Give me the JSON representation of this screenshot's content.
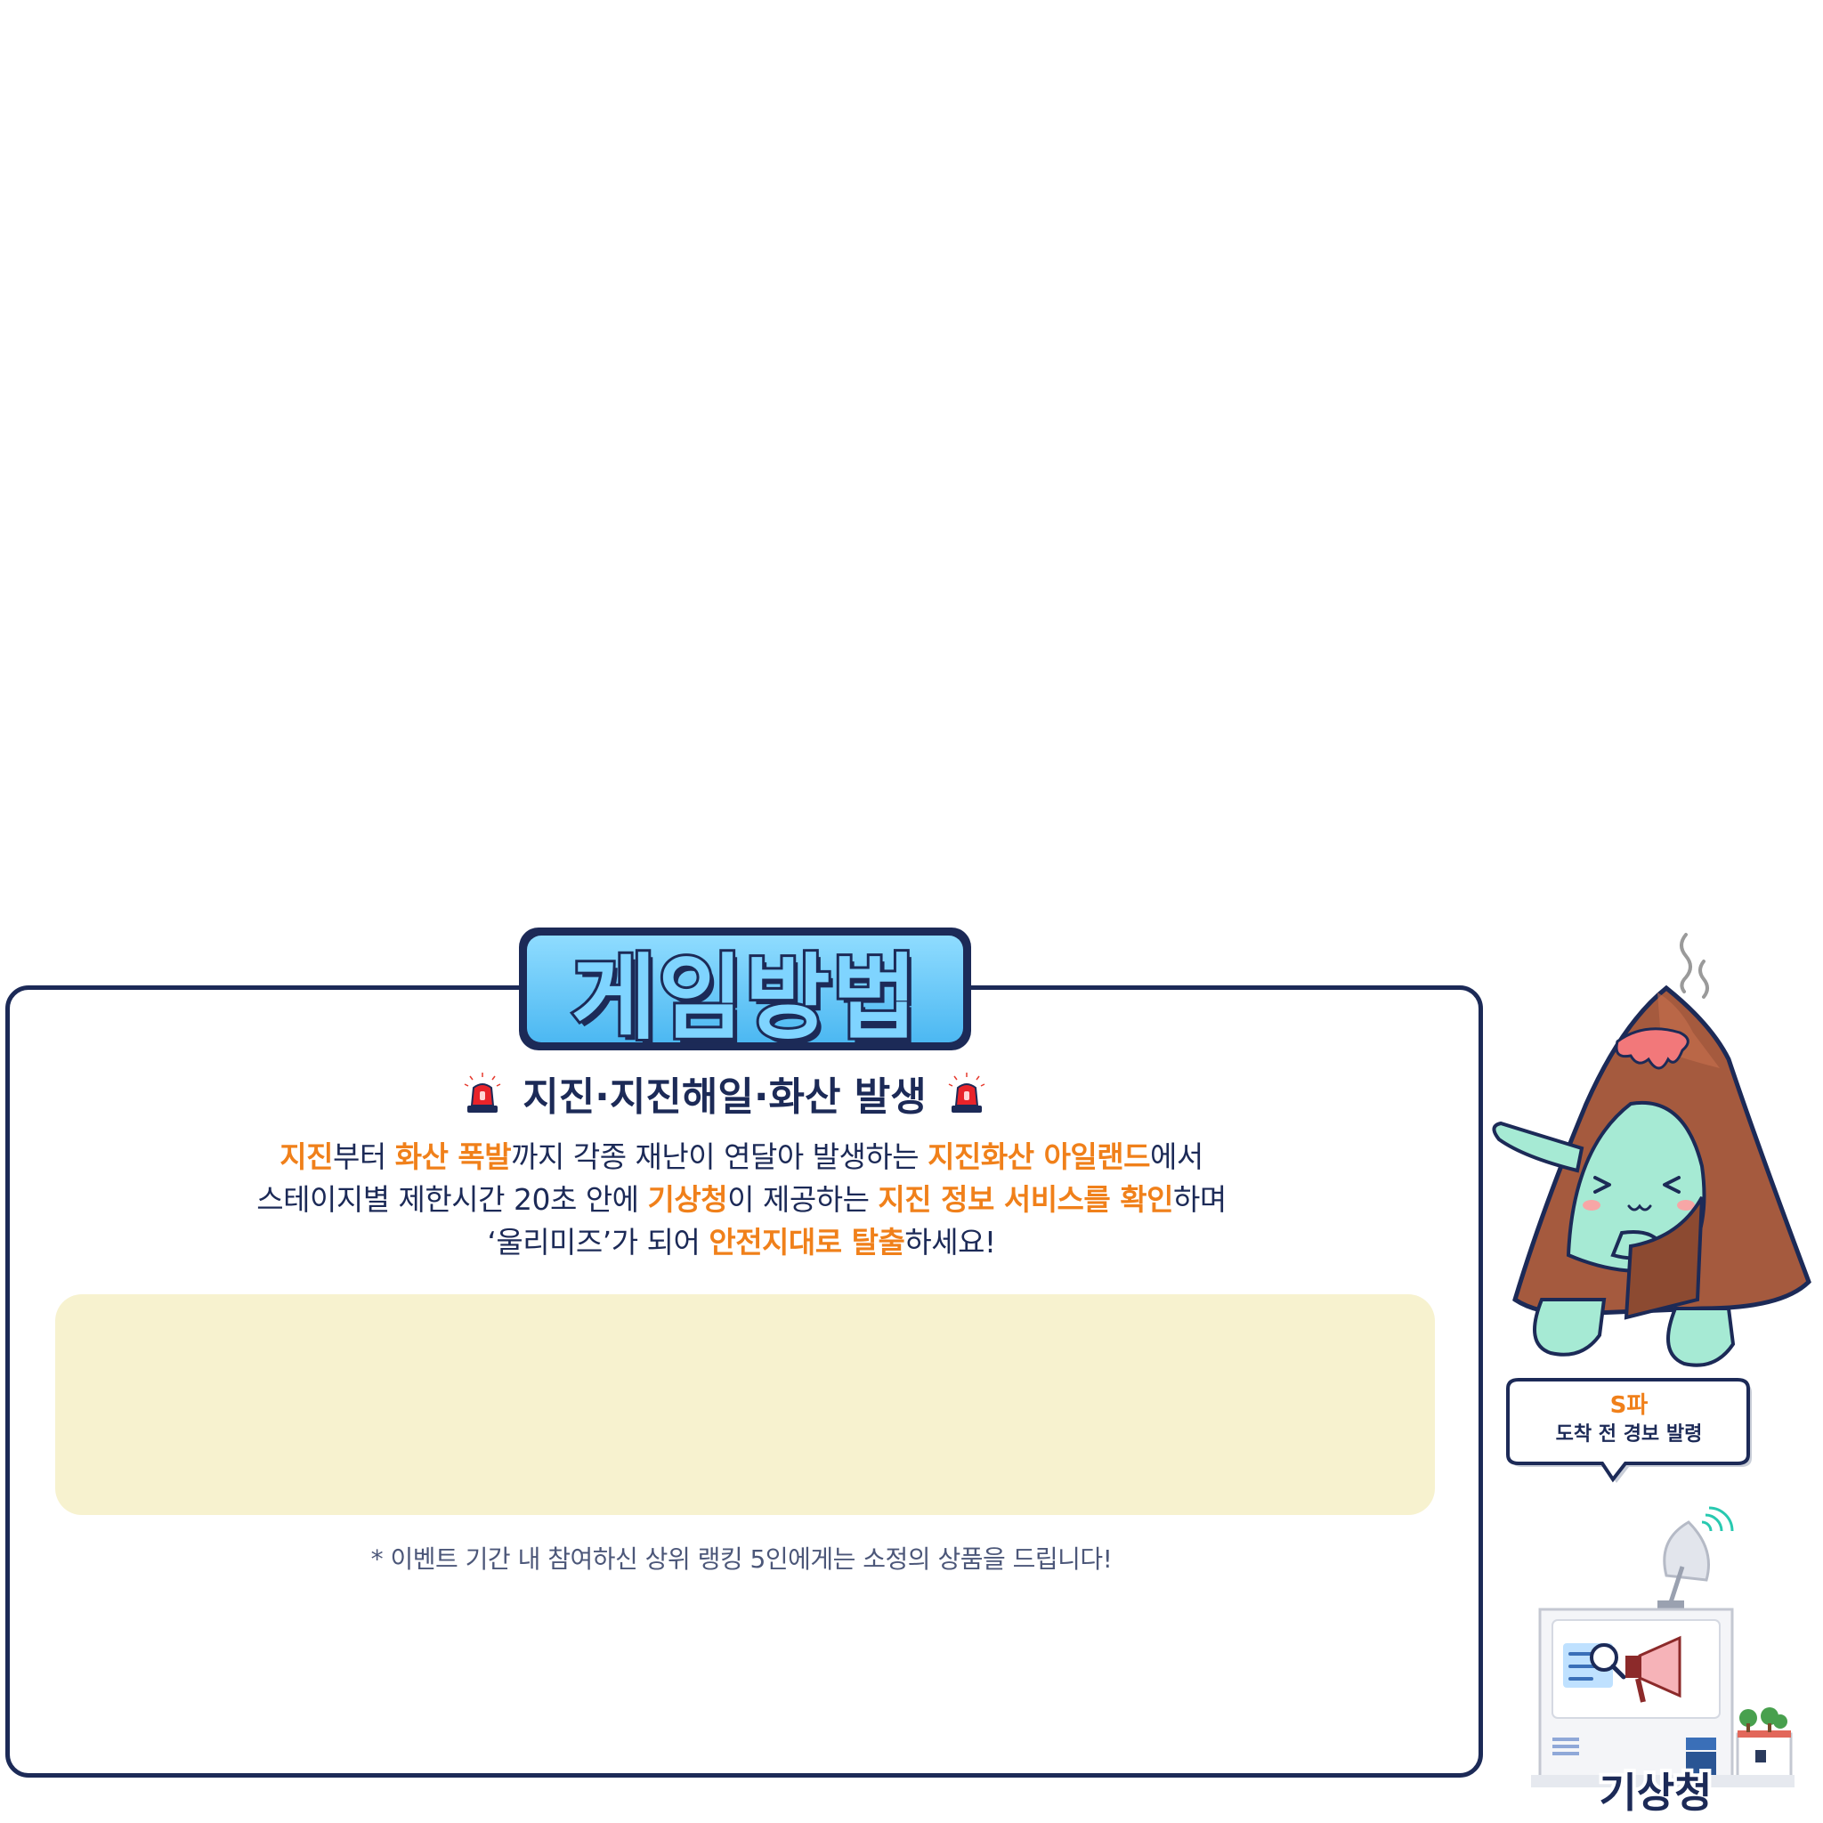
{
  "title": "게임방법",
  "subheading": "지진·지진해일·화산 발생",
  "description": {
    "line1": [
      {
        "text": "지진",
        "hl": true
      },
      {
        "text": "부터 ",
        "hl": false
      },
      {
        "text": "화산 폭발",
        "hl": true
      },
      {
        "text": "까지 각종 재난이 연달아 발생하는 ",
        "hl": false
      },
      {
        "text": "지진화산 아일랜드",
        "hl": true
      },
      {
        "text": "에서",
        "hl": false
      }
    ],
    "line2": [
      {
        "text": "스테이지별 제한시간 20초 안에 ",
        "hl": false
      },
      {
        "text": "기상청",
        "hl": true
      },
      {
        "text": "이 제공하는 ",
        "hl": false
      },
      {
        "text": "지진 정보 서비스를 확인",
        "hl": true
      },
      {
        "text": "하며",
        "hl": false
      }
    ],
    "line3": [
      {
        "text": "‘울리미즈’가 되어 ",
        "hl": false
      },
      {
        "text": "안전지대로 탈출",
        "hl": true
      },
      {
        "text": "하세요!",
        "hl": false
      }
    ]
  },
  "note": "* 이벤트 기간 내 참여하신 상위 랭킹 5인에게는 소정의 상품을 드립니다!",
  "bubble": {
    "line1": "S파",
    "line2": "도착 전 경보 발령"
  },
  "building_label": "기상청",
  "colors": {
    "navy": "#1c2a57",
    "orange": "#f0801a",
    "sky": "#7fd4ff",
    "cream": "#f7f2cf",
    "volcano": "#a55a3e",
    "mint": "#a6ead4"
  },
  "icons": [
    "siren-icon",
    "volcano-mascot",
    "satellite-dish-icon",
    "magnifier-icon",
    "megaphone-icon",
    "tree-icon"
  ]
}
